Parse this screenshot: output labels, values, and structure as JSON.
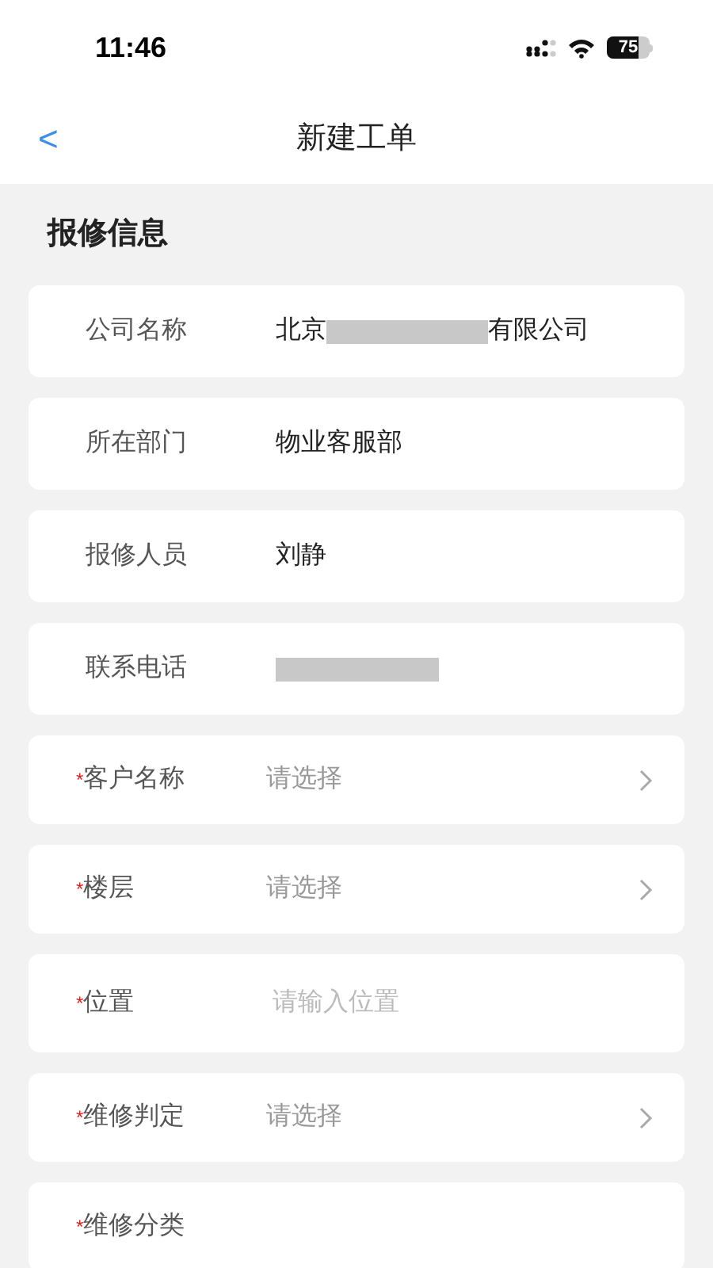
{
  "status_bar": {
    "time": "11:46",
    "battery": "75"
  },
  "header": {
    "back": "<",
    "title": "新建工单"
  },
  "section": {
    "title": "报修信息"
  },
  "rows": [
    {
      "kind": "partly_redacted",
      "label": "公司名称",
      "required": false,
      "value_before": "北京",
      "value_after": "有限公司"
    },
    {
      "kind": "info",
      "label": "所在部门",
      "required": false,
      "value": "物业客服部"
    },
    {
      "kind": "info",
      "label": "报修人员",
      "required": false,
      "value": "刘静"
    },
    {
      "kind": "redacted",
      "label": "联系电话",
      "required": false
    },
    {
      "kind": "select",
      "label": "客户名称",
      "required": true,
      "required_mark": "*",
      "placeholder": "请选择"
    },
    {
      "kind": "select",
      "label": "楼层",
      "required": true,
      "required_mark": "*",
      "placeholder": "请选择"
    },
    {
      "kind": "input",
      "label": "位置",
      "required": true,
      "required_mark": "*",
      "placeholder": "请输入位置"
    },
    {
      "kind": "select",
      "label": "维修判定",
      "required": true,
      "required_mark": "*",
      "placeholder": "请选择"
    },
    {
      "kind": "label_only",
      "label": "维修分类",
      "required": true,
      "required_mark": "*"
    }
  ]
}
